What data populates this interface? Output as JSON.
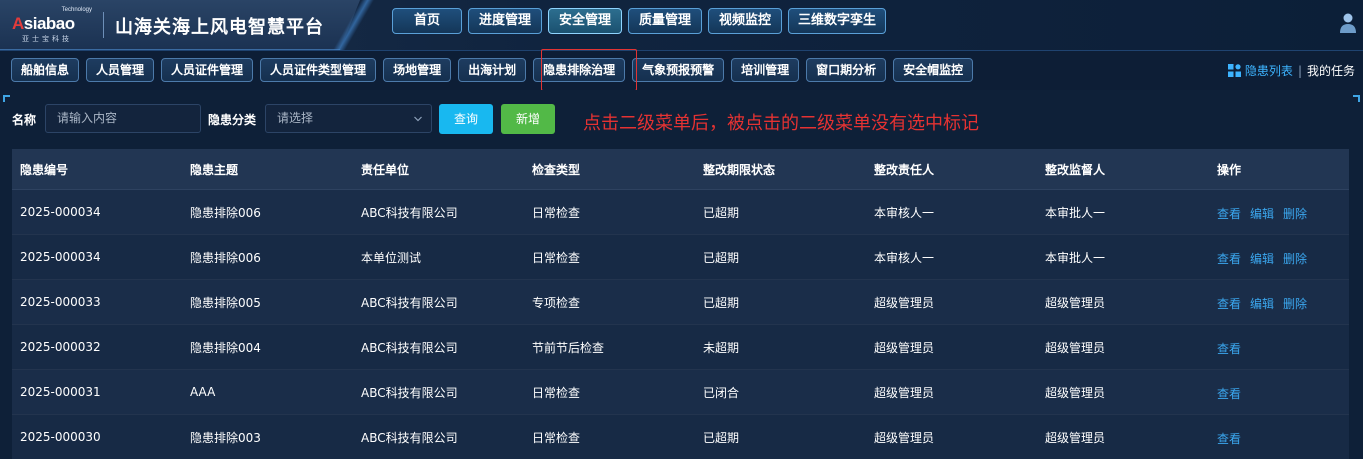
{
  "header": {
    "logo_tech": "Technology",
    "logo_mark_a": "A",
    "logo_mark_rest": "siabao",
    "logo_cn": "亚士宝科技",
    "title": "山海关海上风电智慧平台",
    "nav": [
      "首页",
      "进度管理",
      "安全管理",
      "质量管理",
      "视频监控",
      "三维数字孪生"
    ],
    "active_nav": "安全管理"
  },
  "subnav": {
    "items": [
      "船舶信息",
      "人员管理",
      "人员证件管理",
      "人员证件类型管理",
      "场地管理",
      "出海计划",
      "隐患排除治理",
      "气象预报预警",
      "培训管理",
      "窗口期分析",
      "安全帽监控"
    ],
    "right_link_1": "隐患列表",
    "right_sep": "|",
    "right_link_2": "我的任务"
  },
  "filter": {
    "name_label": "名称",
    "name_placeholder": "请输入内容",
    "category_label": "隐患分类",
    "category_placeholder": "请选择",
    "query_button": "查询",
    "add_button": "新增"
  },
  "notice": "点击二级菜单后，被点击的二级菜单没有选中标记",
  "table": {
    "headers": [
      "隐患编号",
      "隐患主题",
      "责任单位",
      "检查类型",
      "整改期限状态",
      "整改责任人",
      "整改监督人",
      "操作"
    ],
    "rows": [
      {
        "id": "2025-000034",
        "topic": "隐患排除006",
        "unit": "ABC科技有限公司",
        "type": "日常检查",
        "status": "已超期",
        "owner": "本审核人一",
        "supervisor": "本审批人一",
        "ops": [
          "查看",
          "编辑",
          "删除"
        ]
      },
      {
        "id": "2025-000034",
        "topic": "隐患排除006",
        "unit": "本单位测试",
        "type": "日常检查",
        "status": "已超期",
        "owner": "本审核人一",
        "supervisor": "本审批人一",
        "ops": [
          "查看",
          "编辑",
          "删除"
        ]
      },
      {
        "id": "2025-000033",
        "topic": "隐患排除005",
        "unit": "ABC科技有限公司",
        "type": "专项检查",
        "status": "已超期",
        "owner": "超级管理员",
        "supervisor": "超级管理员",
        "ops": [
          "查看",
          "编辑",
          "删除"
        ]
      },
      {
        "id": "2025-000032",
        "topic": "隐患排除004",
        "unit": "ABC科技有限公司",
        "type": "节前节后检查",
        "status": "未超期",
        "owner": "超级管理员",
        "supervisor": "超级管理员",
        "ops": [
          "查看"
        ]
      },
      {
        "id": "2025-000031",
        "topic": "AAA",
        "unit": "ABC科技有限公司",
        "type": "日常检查",
        "status": "已闭合",
        "owner": "超级管理员",
        "supervisor": "超级管理员",
        "ops": [
          "查看"
        ]
      },
      {
        "id": "2025-000030",
        "topic": "隐患排除003",
        "unit": "ABC科技有限公司",
        "type": "日常检查",
        "status": "已超期",
        "owner": "超级管理员",
        "supervisor": "超级管理员",
        "ops": [
          "查看"
        ]
      }
    ]
  },
  "colors": {
    "accent": "#18b8f0",
    "add": "#52b947",
    "link": "#3ba7ef",
    "notice": "#e53232"
  },
  "icons": {
    "user": "user-icon",
    "list": "grid-list-icon",
    "dropdown": "chevron-down-icon"
  }
}
